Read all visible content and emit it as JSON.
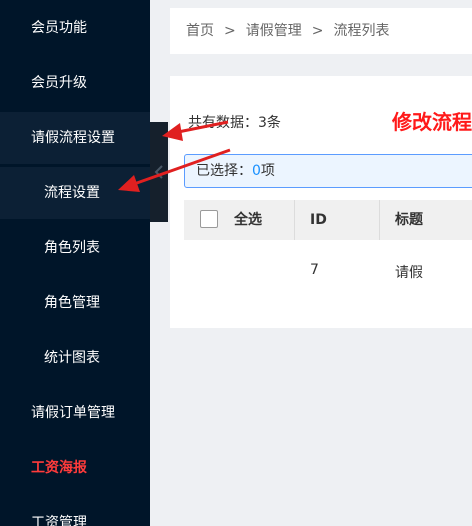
{
  "sidebar": {
    "items": [
      {
        "label": "会员功能"
      },
      {
        "label": "会员升级"
      },
      {
        "label": "请假流程设置"
      },
      {
        "label": "流程设置"
      },
      {
        "label": "角色列表"
      },
      {
        "label": "角色管理"
      },
      {
        "label": "统计图表"
      },
      {
        "label": "请假订单管理"
      },
      {
        "label": "工资海报"
      },
      {
        "label": "工资管理"
      }
    ]
  },
  "breadcrumb": {
    "items": [
      "首页",
      "请假管理",
      "流程列表"
    ],
    "separator": ">"
  },
  "panel": {
    "total_label": "共有数据：3条",
    "annotation_title": "修改流程",
    "selection_prefix": "已选择：",
    "selection_count": "0",
    "selection_suffix": "项"
  },
  "table": {
    "columns": [
      "全选",
      "ID",
      "标题"
    ],
    "rows": [
      {
        "id": "7",
        "title": "请假"
      }
    ]
  },
  "colors": {
    "sidebar_bg": "#001529",
    "accent_red": "#ff1a1a",
    "link_blue": "#1890ff",
    "arrow_red": "#e02020"
  }
}
